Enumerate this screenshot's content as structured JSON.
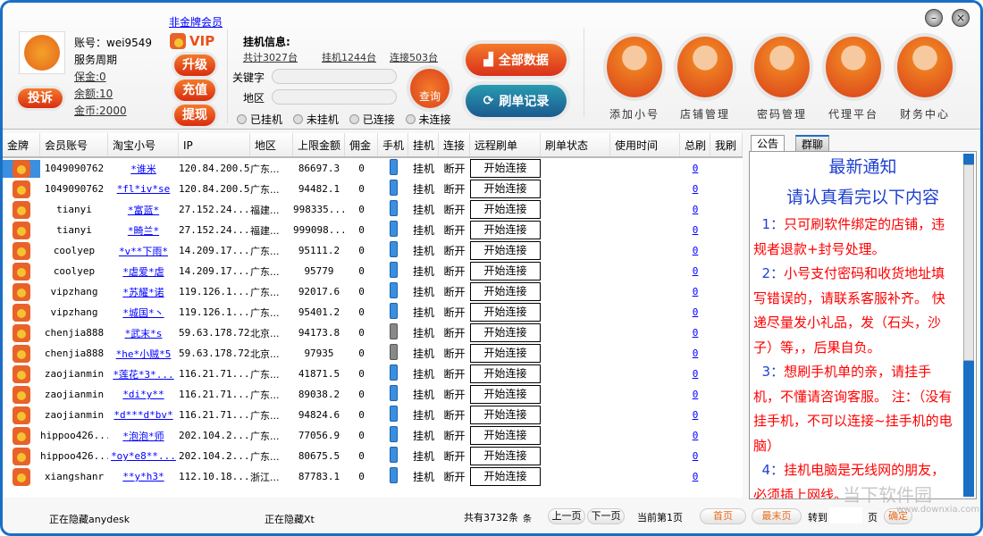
{
  "account": {
    "label": "账号：wei9549",
    "service": "服务周期",
    "deposit": "保金:0",
    "balance": "余额:10",
    "coins": "金币:2000",
    "complain": "投诉"
  },
  "member": {
    "non_gold": "非金牌会员",
    "vip": "VIP",
    "upgrade": "升级",
    "recharge": "充值",
    "withdraw": "提现"
  },
  "hangup": {
    "title": "挂机信息:",
    "total": "共计3027台",
    "hanging": "挂机1244台",
    "connected": "连接503台",
    "keyword_label": "关键字",
    "keyword_value": "",
    "region_label": "地区",
    "region_value": "",
    "search": "查询",
    "radios": [
      "已挂机",
      "未挂机",
      "已连接",
      "未连接"
    ]
  },
  "actions": {
    "all_data": "全部数据",
    "records": "刷单记录"
  },
  "tools": [
    "添加小号",
    "店铺管理",
    "密码管理",
    "代理平台",
    "财务中心"
  ],
  "window": {
    "minimize": "–",
    "close": "×"
  },
  "table": {
    "columns": [
      "金牌",
      "会员账号",
      "淘宝小号",
      "IP",
      "地区",
      "上限金额",
      "佣金",
      "手机",
      "挂机",
      "连接",
      "远程刷单",
      "刷单状态",
      "使用时间",
      "总刷",
      "我刷"
    ],
    "rows": [
      [
        "1049090762",
        "*谁米",
        "120.84.200.5",
        "广东...",
        "86697.3",
        "0",
        "blue",
        "挂机",
        "断开",
        "开始连接",
        "",
        "",
        "0",
        ""
      ],
      [
        "1049090762",
        "*fl*iv*se",
        "120.84.200.5",
        "广东...",
        "94482.1",
        "0",
        "blue",
        "挂机",
        "断开",
        "开始连接",
        "",
        "",
        "0",
        ""
      ],
      [
        "tianyi",
        "*富蓝*",
        "27.152.24...",
        "福建...",
        "998335...",
        "0",
        "blue",
        "挂机",
        "断开",
        "开始连接",
        "",
        "",
        "0",
        ""
      ],
      [
        "tianyi",
        "*畸兰*",
        "27.152.24...",
        "福建...",
        "999098...",
        "0",
        "blue",
        "挂机",
        "断开",
        "开始连接",
        "",
        "",
        "0",
        ""
      ],
      [
        "coolyep",
        "*v**下雨*",
        "14.209.17...",
        "广东...",
        "95111.2",
        "0",
        "blue",
        "挂机",
        "断开",
        "开始连接",
        "",
        "",
        "0",
        ""
      ],
      [
        "coolyep",
        "*虐爱*虐",
        "14.209.17...",
        "广东...",
        "95779",
        "0",
        "blue",
        "挂机",
        "断开",
        "开始连接",
        "",
        "",
        "0",
        ""
      ],
      [
        "vipzhang",
        "*苏耀*诺",
        "119.126.1...",
        "广东...",
        "92017.6",
        "0",
        "blue",
        "挂机",
        "断开",
        "开始连接",
        "",
        "",
        "0",
        ""
      ],
      [
        "vipzhang",
        "*城国*丶",
        "119.126.1...",
        "广东...",
        "95401.2",
        "0",
        "blue",
        "挂机",
        "断开",
        "开始连接",
        "",
        "",
        "0",
        ""
      ],
      [
        "chenjia888",
        "*武末*s",
        "59.63.178.72",
        "北京...",
        "94173.8",
        "0",
        "gray",
        "挂机",
        "断开",
        "开始连接",
        "",
        "",
        "0",
        ""
      ],
      [
        "chenjia888",
        "*he*小贼*5",
        "59.63.178.72",
        "北京...",
        "97935",
        "0",
        "gray",
        "挂机",
        "断开",
        "开始连接",
        "",
        "",
        "0",
        ""
      ],
      [
        "zaojianmin",
        "*莲花*3*...",
        "116.21.71...",
        "广东...",
        "41871.5",
        "0",
        "blue",
        "挂机",
        "断开",
        "开始连接",
        "",
        "",
        "0",
        ""
      ],
      [
        "zaojianmin",
        "*di*y**",
        "116.21.71...",
        "广东...",
        "89038.2",
        "0",
        "blue",
        "挂机",
        "断开",
        "开始连接",
        "",
        "",
        "0",
        ""
      ],
      [
        "zaojianmin",
        "*d***d*bv*",
        "116.21.71...",
        "广东...",
        "94824.6",
        "0",
        "blue",
        "挂机",
        "断开",
        "开始连接",
        "",
        "",
        "0",
        ""
      ],
      [
        "hippoo426...",
        "*泡泡*师",
        "202.104.2...",
        "广东...",
        "77056.9",
        "0",
        "blue",
        "挂机",
        "断开",
        "开始连接",
        "",
        "",
        "0",
        ""
      ],
      [
        "hippoo426...",
        "*oy*e8**...",
        "202.104.2...",
        "广东...",
        "80675.5",
        "0",
        "blue",
        "挂机",
        "断开",
        "开始连接",
        "",
        "",
        "0",
        ""
      ],
      [
        "xiangshanr",
        "**y*h3*",
        "112.10.18...",
        "浙江...",
        "87783.1",
        "0",
        "blue",
        "挂机",
        "断开",
        "开始连接",
        "",
        "",
        "0",
        ""
      ]
    ]
  },
  "notice": {
    "tabs": [
      "公告",
      "群聊"
    ],
    "title": "最新通知",
    "subtitle": "请认真看完以下内容",
    "items": [
      {
        "num": "1：",
        "text": "只可刷软件绑定的店铺，违规者退款+封号处理。"
      },
      {
        "num": "2：",
        "text": "小号支付密码和收货地址填写错误的，请联系客服补齐。 快递尽量发小礼品，发（石头，沙子）等，，后果自负。"
      },
      {
        "num": "3：",
        "text": "想刷手机单的亲，请挂手机，不懂请咨询客服。 注：（没有挂手机，不可以连接~挂手机的电脑）"
      },
      {
        "num": "4：",
        "text": "挂机电脑是无线网的朋友，必须插上网线。"
      }
    ]
  },
  "footer": {
    "status1": "正在隐藏anydesk",
    "status2": "正在隐藏Xt",
    "total": "共有3732条",
    "unit": "条",
    "prev": "上一页",
    "next": "下一页",
    "current": "当前第1页",
    "first": "首页",
    "last": "最末页",
    "goto": "转到",
    "goto_value": "",
    "page": "页",
    "confirm": "确定"
  },
  "watermark": {
    "brand": "当下软件园",
    "url": "www.downxia.com"
  }
}
